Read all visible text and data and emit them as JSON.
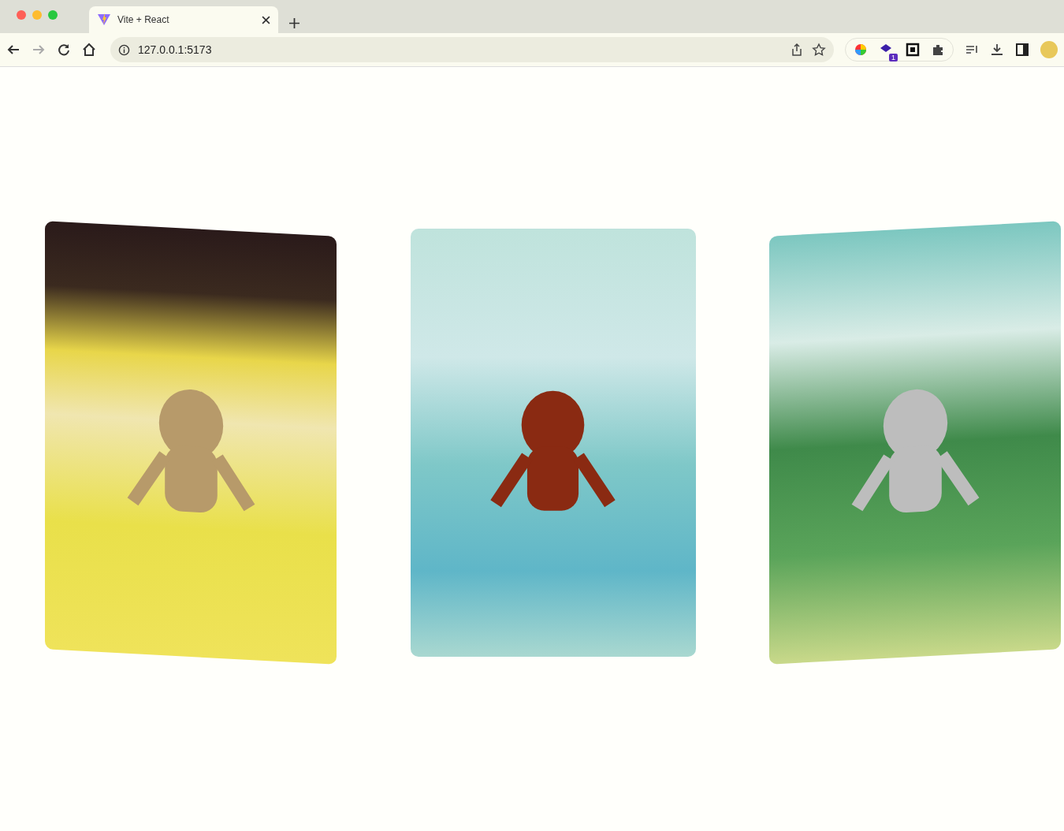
{
  "browser": {
    "tab": {
      "title": "Vite + React",
      "selected": true
    },
    "address": "127.0.0.1:5173",
    "extension_badge": "1"
  },
  "cards": [
    {
      "kind": "tilt-left"
    },
    {
      "kind": "flat"
    },
    {
      "kind": "tilt-right"
    }
  ]
}
